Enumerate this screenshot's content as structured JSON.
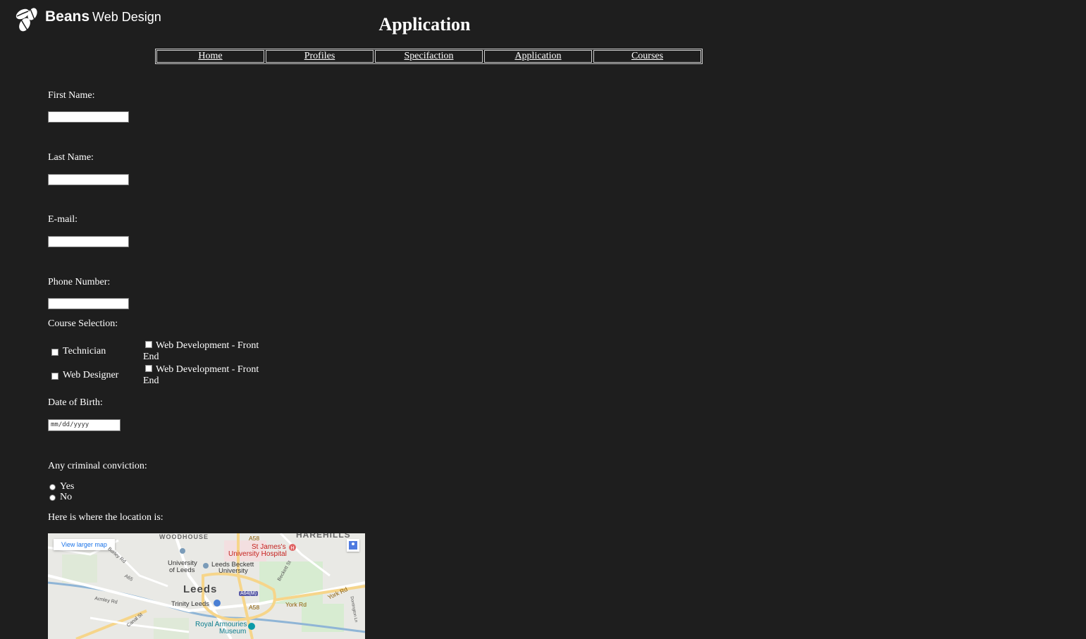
{
  "header": {
    "logo_bold": "Beans",
    "logo_light": "Web Design",
    "title": "Application"
  },
  "nav": [
    "Home",
    "Profiles",
    "Specifaction",
    "Application",
    "Courses"
  ],
  "form": {
    "first_name_label": "First Name:",
    "last_name_label": "Last Name:",
    "email_label": "E-mail:",
    "phone_label": "Phone Number:",
    "course_label": "Course Selection:",
    "courses": [
      "Technician",
      "Web Designer",
      "Web Development - Front End",
      "Web Development - Front End"
    ],
    "dob_label": "Date of Birth:",
    "dob_placeholder": "mm/dd/yyyy",
    "criminal_label": "Any criminal conviction:",
    "criminal_options": [
      "Yes",
      "No"
    ],
    "location_label": "Here is where the location is:"
  },
  "map": {
    "button": "View larger map",
    "labels": {
      "woodhouse": "WOODHOUSE",
      "harehills": "HAREHILLS",
      "a58": "A58",
      "a58b": "A58",
      "st_james": "St James's",
      "st_james_hosp": "University Hospital",
      "univ": "University",
      "of_leeds": "of Leeds",
      "beckett1": "Leeds Beckett",
      "beckett2": "University",
      "city": "Leeds",
      "a64m": "A64(M)",
      "trinity": "Trinity Leeds",
      "york_rd": "York Rd",
      "york_rd2": "York Rd",
      "royal1": "Royal Armouries",
      "royal2": "Museum",
      "armley": "Armley Rd",
      "canal": "Canal St",
      "burley": "Burley Rd",
      "a65": "A65",
      "beckett_st": "Beckett St",
      "dontington": "Dontington Ln"
    }
  },
  "colors": {
    "background": "#1e1e1e",
    "text": "#ffffff",
    "nav_border": "#cfcfcf"
  }
}
